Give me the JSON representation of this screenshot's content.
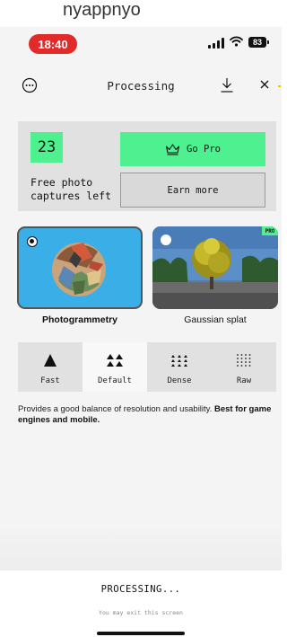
{
  "background_text": "nyappnyo",
  "status_bar": {
    "time": "18:40",
    "battery": "83"
  },
  "header": {
    "title": "Processing",
    "menu_icon": "ellipsis-circle-icon",
    "download_icon": "download-icon",
    "close_icon": "close-icon"
  },
  "captures": {
    "count": "23",
    "label": "Free photo captures left",
    "go_pro_label": "Go Pro",
    "go_pro_icon": "crown-icon",
    "earn_more_label": "Earn more"
  },
  "modes": [
    {
      "label": "Photogrammetry",
      "selected": true
    },
    {
      "label": "Gaussian splat",
      "selected": false,
      "badge": "PRO"
    }
  ],
  "density": {
    "selected": "Default",
    "options": [
      {
        "label": "Fast"
      },
      {
        "label": "Default"
      },
      {
        "label": "Dense"
      },
      {
        "label": "Raw"
      }
    ]
  },
  "description": {
    "text": "Provides a good balance of resolution and usability.",
    "emphasis": "Best for game engines and mobile."
  },
  "footer": {
    "status": "PROCESSING...",
    "note": "You may exit this screen"
  },
  "colors": {
    "accent_green": "#4ff08f",
    "status_pill_red": "#e12b2b",
    "photo_card_blue": "#3aaee6"
  }
}
